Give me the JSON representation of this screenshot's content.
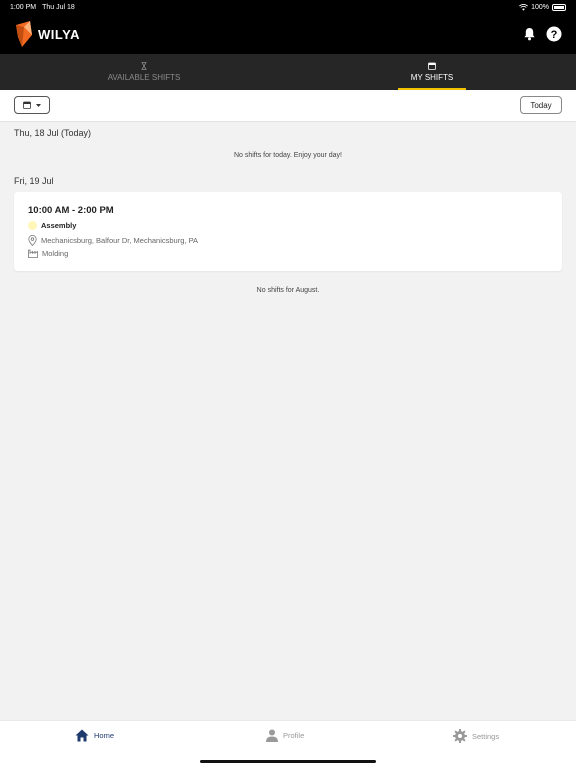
{
  "status_bar": {
    "time": "1:00 PM",
    "date": "Thu Jul 18",
    "battery": "100%"
  },
  "app": {
    "logo_text": "WILYA"
  },
  "tabs": [
    {
      "label": "AVAILABLE SHIFTS",
      "icon": "hourglass-icon"
    },
    {
      "label": "MY SHIFTS",
      "icon": "calendar-icon"
    }
  ],
  "toolbar": {
    "today_label": "Today"
  },
  "days": [
    {
      "header": "Thu, 18 Jul (Today)",
      "empty_message": "No shifts for today. Enjoy your day!"
    },
    {
      "header": "Fri, 19 Jul"
    }
  ],
  "shift": {
    "time": "10:00 AM - 2:00 PM",
    "department": "Assembly",
    "location": "Mechanicsburg, Balfour Dr, Mechanicsburg, PA",
    "area": "Molding",
    "department_color": "#fff7b8"
  },
  "month_message": "No shifts for August.",
  "bottom_nav": [
    {
      "label": "Home",
      "icon": "home-icon"
    },
    {
      "label": "Profile",
      "icon": "person-icon"
    },
    {
      "label": "Settings",
      "icon": "gear-icon"
    }
  ],
  "colors": {
    "accent": "#f2c200",
    "nav_active": "#1f3a6e",
    "logo_orange": "#f26a21"
  }
}
